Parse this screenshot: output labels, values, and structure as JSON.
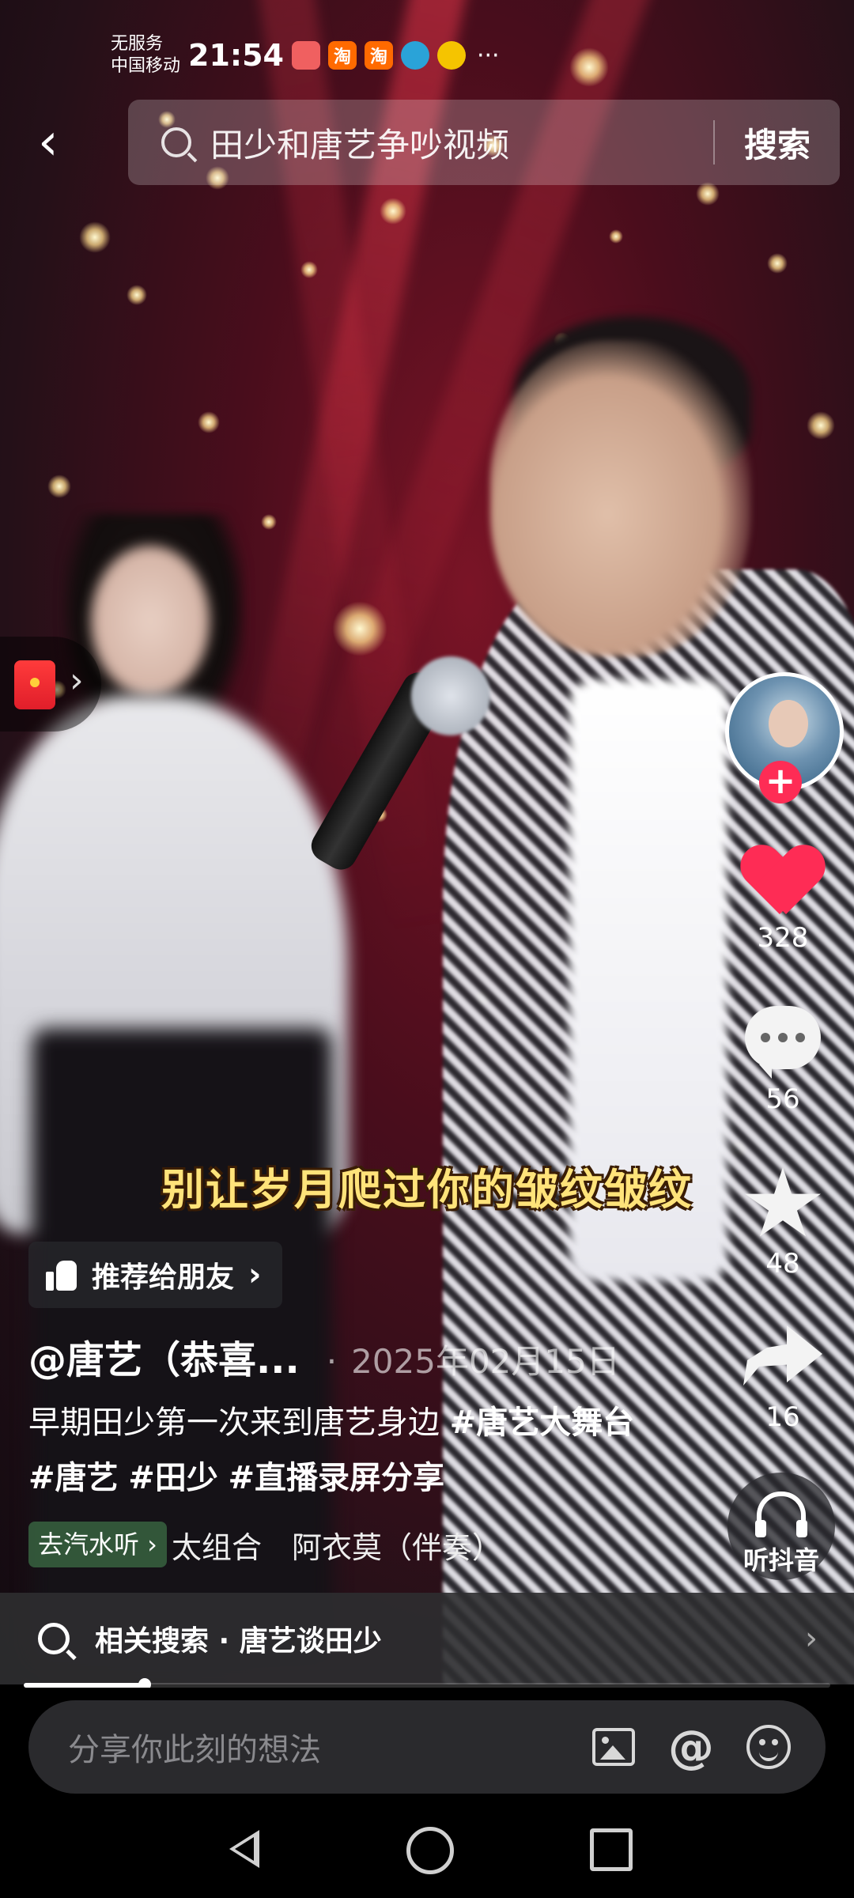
{
  "status_bar": {
    "carrier_line1": "无服务",
    "carrier_line2": "中国移动",
    "time": "21:54",
    "apps": [
      {
        "icon": "app-icon",
        "label": "",
        "color": "#f06060"
      },
      {
        "icon": "taobao-icon",
        "label": "淘",
        "color": "#ff6a00"
      },
      {
        "icon": "taobao-icon",
        "label": "淘",
        "color": "#ff6a00"
      },
      {
        "icon": "mobile-icon",
        "label": "",
        "color": "#2aa3d8"
      },
      {
        "icon": "weibo-icon",
        "label": "",
        "color": "#f5c400"
      }
    ],
    "more": "···"
  },
  "search": {
    "back_icon": "‹",
    "query": "田少和唐艺争吵视频",
    "button_label": "搜索"
  },
  "video": {
    "subtitle": "别让岁月爬过你的皱纹皱纹"
  },
  "actions": {
    "likes": "328",
    "comments": "56",
    "favorites": "48",
    "shares": "16",
    "follow_plus": "+",
    "listen_label": "听抖音"
  },
  "post": {
    "recommend_label": "推荐给朋友",
    "author": "@唐艺（恭喜...",
    "date": "2025年02月15日",
    "description_text": "早期田少第一次来到唐艺身边",
    "tags": [
      "#唐艺大舞台",
      "#唐艺",
      "#田少",
      "#直播录屏分享"
    ],
    "music_tag": "去汽水听 ›",
    "music_text": "太组合　阿衣莫（伴奏）"
  },
  "related": {
    "text": "相关搜索 · 唐艺谈田少",
    "chevron": "›"
  },
  "progress": {
    "value": 0.15
  },
  "comment": {
    "placeholder": "分享你此刻的想法"
  },
  "colors": {
    "accent": "#fe2c55",
    "subtitle": "#ffe37a"
  }
}
